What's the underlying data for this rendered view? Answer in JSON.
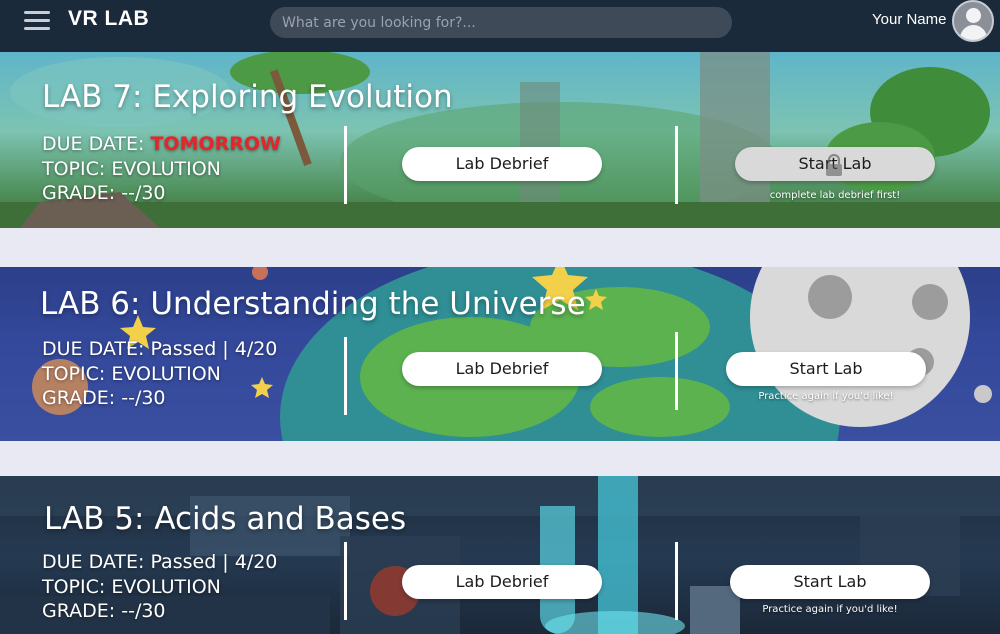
{
  "header": {
    "brand": "VR LAB",
    "search_placeholder": "What are you looking for?...",
    "user_name": "Your Name"
  },
  "labs": [
    {
      "title": "LAB 7: Exploring Evolution",
      "due_label": "DUE DATE: ",
      "due_value": "TOMORROW",
      "topic": "TOPIC: EVOLUTION",
      "grade": "GRADE: --/30",
      "debrief_label": "Lab Debrief",
      "start_label": "Start Lab",
      "start_locked": true,
      "note": "complete lab debrief first!"
    },
    {
      "title": "LAB 6: Understanding the Universe",
      "due_label": "DUE DATE: ",
      "due_value": "Passed | 4/20",
      "topic": "TOPIC: EVOLUTION",
      "grade": "GRADE: --/30",
      "debrief_label": "Lab Debrief",
      "start_label": "Start Lab",
      "start_locked": false,
      "note": "Practice again if you'd like!"
    },
    {
      "title": "LAB 5: Acids and Bases",
      "due_label": "DUE DATE: ",
      "due_value": "Passed | 4/20",
      "topic": "TOPIC: EVOLUTION",
      "grade": "GRADE: --/30",
      "debrief_label": "Lab Debrief",
      "start_label": "Start Lab",
      "start_locked": false,
      "note": "Practice again if you'd like!"
    }
  ],
  "colors": {
    "topbar": "#1b2a3a",
    "due_alert": "#e5252a",
    "button": "#ffffff",
    "button_locked": "#d9d9d9"
  },
  "icons": {
    "menu": "hamburger-menu-icon",
    "avatar": "user-avatar-icon",
    "lock": "lock-icon"
  }
}
